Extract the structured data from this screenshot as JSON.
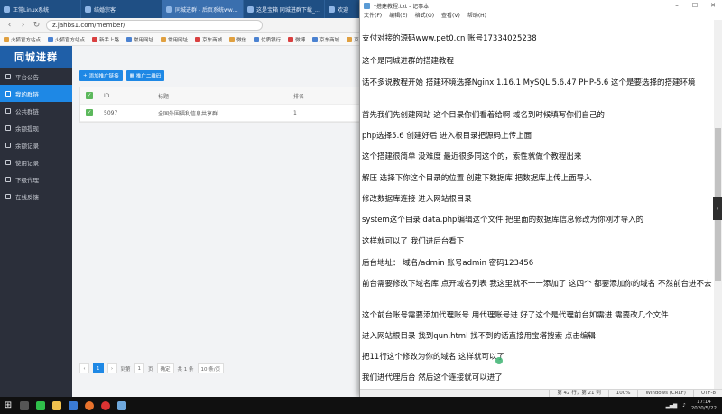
{
  "browser": {
    "tabs": [
      {
        "label": "正常Linux系统"
      },
      {
        "label": "结婚宗客"
      },
      {
        "label": "同城进群 - 后页系统www.heiyou..."
      },
      {
        "label": "这是宝箱 同城进群下载_链接..."
      },
      {
        "label": "欢迎"
      }
    ],
    "url": "z.jahbs1.com/member/",
    "bookmarks": [
      "火狐官方站点",
      "火狐官方站点",
      "新手上路",
      "常用网址",
      "常用网址",
      "京东商城",
      "微信",
      "优质银行",
      "微博",
      "京东商城",
      "京东商城",
      "网球"
    ]
  },
  "admin": {
    "logo": "同城进群",
    "menu": [
      {
        "label": "平台公告"
      },
      {
        "label": "我的群链",
        "active": true
      },
      {
        "label": "公共群链"
      },
      {
        "label": "余额提现"
      },
      {
        "label": "余额记录"
      },
      {
        "label": "使用记录"
      },
      {
        "label": "下级代理"
      },
      {
        "label": "在线反馈"
      }
    ],
    "toolbar": {
      "btn1": "添加推广链接",
      "btn2": "推广二维码"
    },
    "table": {
      "headers": {
        "id": "ID",
        "title": "标题",
        "sort": "排名"
      },
      "rows": [
        {
          "id": "5097",
          "title": "全国外围福利信息共享群",
          "sort": "1"
        }
      ]
    },
    "pager": {
      "page": "1",
      "goto": "1",
      "confirm": "确定",
      "total": "共 1 条",
      "per_page": "10 条/页"
    }
  },
  "notepad": {
    "title": "*搭建教程.txt - 记事本",
    "menu": [
      "文件(F)",
      "编辑(E)",
      "格式(O)",
      "查看(V)",
      "帮助(H)"
    ],
    "lines": [
      "支付对接的源码www.pet0.cn  账号17334025238",
      "这个是同城进群的搭建教程",
      "话不多说教程开始  搭建环境选择Nginx 1.16.1  MySQL 5.6.47  PHP-5.6 这个是要选择的搭建环境",
      "首先我们先创建网站  这个目录你们看着给啊  域名到时候填写你们自己的",
      "php选择5.6  创建好后 进入根目录把源码上传上面",
      "这个搭建很简单 没难度  最近很多同这个的，索性就做个教程出来",
      "解压  选择下你这个目录的位置  创建下数据库  把数据库上传上面导入",
      "修改数据库连接 进入网站根目录",
      "system这个目录  data.php编辑这个文件  把里面的数据库信息修改为你刚才导入的",
      "这样就可以了 我们进后台看下",
      "后台地址：  域名/admin   账号admin  密码123456",
      "前台需要修改下域名库  点开域名列表  我这里就不一一添加了  这四个 都要添加你的域名 不然前台进不去",
      "这个前台账号需要添加代理账号 用代理账号进  好了这个是代理前台如需进 需要改几个文件",
      "进入网站根目录 找到qun.html  找不到的话直接用宝塔搜索  点击编辑",
      "把11行这个修改为你的域名  这样就可以了",
      "我们进代理后台  然后这个连接就可以进了"
    ],
    "status": {
      "position": "第 42 行，第 21 列",
      "zoom": "100%",
      "eol": "Windows (CRLF)",
      "encoding": "UTF-8"
    }
  },
  "taskbar": {
    "apps": [
      {
        "icon": "windows-start-icon"
      },
      {
        "icon": "search-icon"
      },
      {
        "icon": "wechat-icon"
      },
      {
        "icon": "file-explorer-icon"
      },
      {
        "icon": "browser-icon"
      },
      {
        "icon": "firefox-icon"
      },
      {
        "icon": "recorder-icon"
      },
      {
        "icon": "notepad-icon"
      }
    ],
    "time": "17:14",
    "date": "2020/5/22"
  }
}
